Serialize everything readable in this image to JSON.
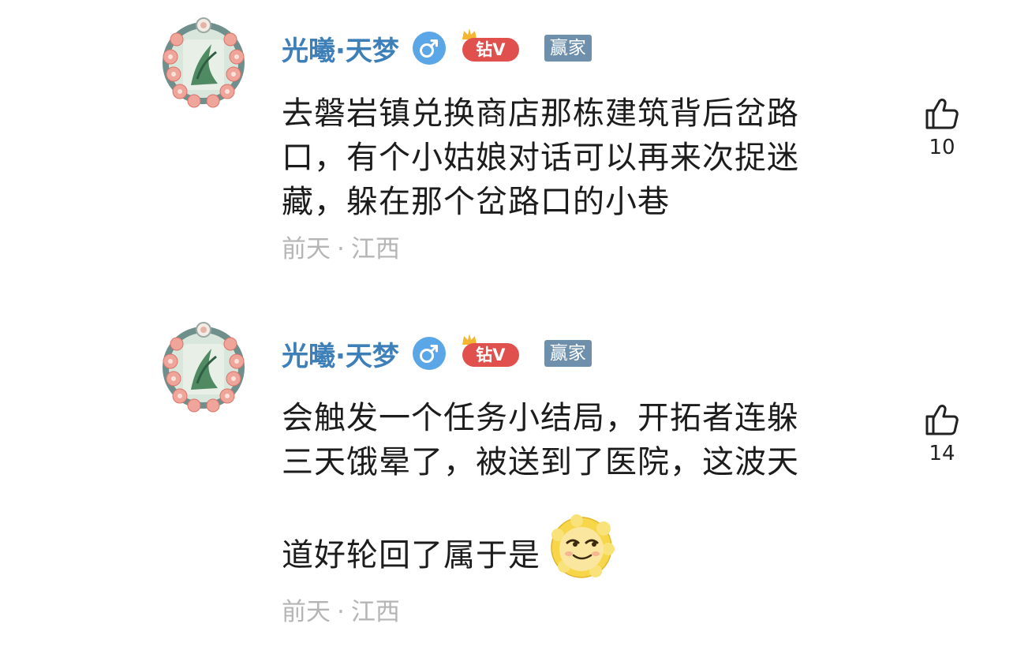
{
  "colors": {
    "username": "#3d7fb8",
    "vip_badge": "#e0504d",
    "winner_badge": "#6f90ad",
    "meta_text": "#b5b5b5"
  },
  "comments": [
    {
      "username": "光曦·天梦",
      "gender_icon": "male-icon",
      "vip_badge": "钻V",
      "title_badge": "赢家",
      "text_lines": [
        "去磐岩镇兑换商店那栋建筑背后岔路",
        "口，有个小姑娘对话可以再来次捉迷",
        "藏，躲在那个岔路口的小巷"
      ],
      "time": "前天",
      "location": "江西",
      "likes": "10"
    },
    {
      "username": "光曦·天梦",
      "gender_icon": "male-icon",
      "vip_badge": "钻V",
      "title_badge": "赢家",
      "text_lines": [
        "会触发一个任务小结局，开拓者连躲",
        "三天饿晕了，被送到了医院，这波天",
        "道好轮回了属于是"
      ],
      "emoji": "smirk-lion-emoji",
      "time": "前天",
      "location": "江西",
      "likes": "14"
    }
  ]
}
